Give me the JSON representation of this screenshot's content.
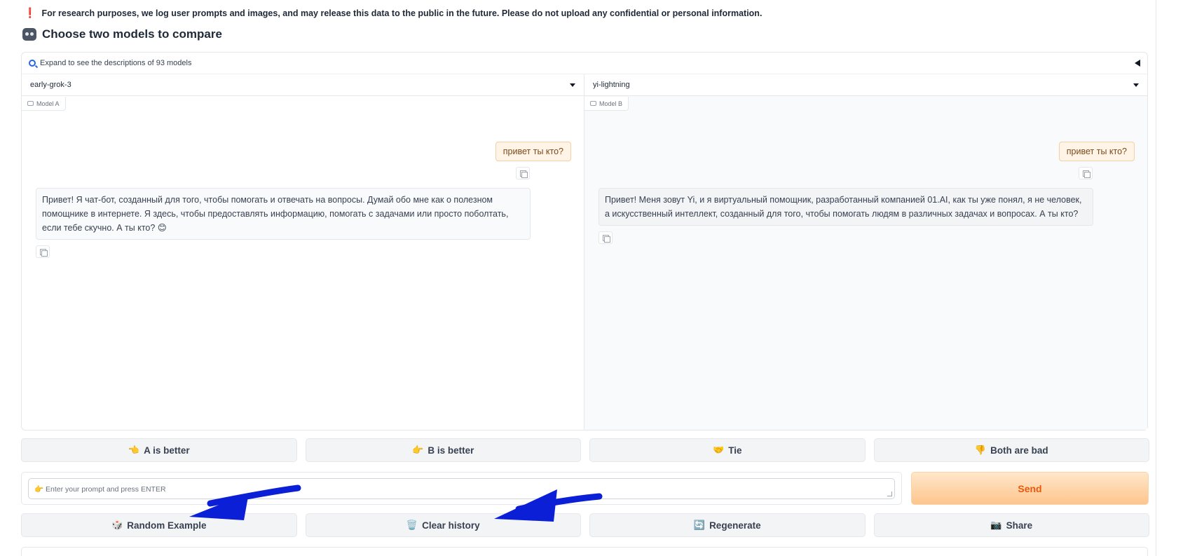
{
  "notice": {
    "icon": "exclamation-icon",
    "text": "For research purposes, we log user prompts and images, and may release this data to the public in the future. Please do not upload any confidential or personal information."
  },
  "header": {
    "icon": "robot-icon",
    "title": "Choose two models to compare"
  },
  "expand": {
    "icon": "magnifier-icon",
    "label": "Expand to see the descriptions of 93 models"
  },
  "model_a": {
    "selected": "early-grok-3",
    "tag": "Model A",
    "user_message": "привет ты кто?",
    "bot_message": "Привет! Я чат-бот, созданный для того, чтобы помогать и отвечать на вопросы. Думай обо мне как о полезном помощнике в интернете. Я здесь, чтобы предоставлять информацию, помогать с задачами или просто поболтать, если тебе скучно. А ты кто? 😊"
  },
  "model_b": {
    "selected": "yi-lightning",
    "tag": "Model B",
    "user_message": "привет ты кто?",
    "bot_message": "Привет! Меня зовут Yi, и я виртуальный помощник, разработанный компанией 01.AI, как ты уже понял, я не человек, а искусственный интеллект, созданный для того, чтобы помогать людям в различных задачах и вопросах. А ты кто?"
  },
  "votes": {
    "a_better": {
      "emoji": "👈",
      "label": "A is better"
    },
    "b_better": {
      "emoji": "👉",
      "label": "B is better"
    },
    "tie": {
      "emoji": "🤝",
      "label": "Tie"
    },
    "both_bad": {
      "emoji": "👎",
      "label": "Both are bad"
    }
  },
  "prompt": {
    "placeholder": "👉 Enter your prompt and press ENTER",
    "send_label": "Send"
  },
  "actions": {
    "random": {
      "emoji": "🎲",
      "label": "Random Example"
    },
    "clear": {
      "emoji": "🗑️",
      "label": "Clear history"
    },
    "regenerate": {
      "emoji": "🔄",
      "label": "Regenerate"
    },
    "share": {
      "emoji": "📷",
      "label": "Share"
    }
  },
  "colors": {
    "send_gradient_top": "#ffe7c9",
    "send_gradient_bottom": "#fdc58d",
    "send_text": "#ea580c",
    "annotation_arrow": "#0a1fd6"
  }
}
